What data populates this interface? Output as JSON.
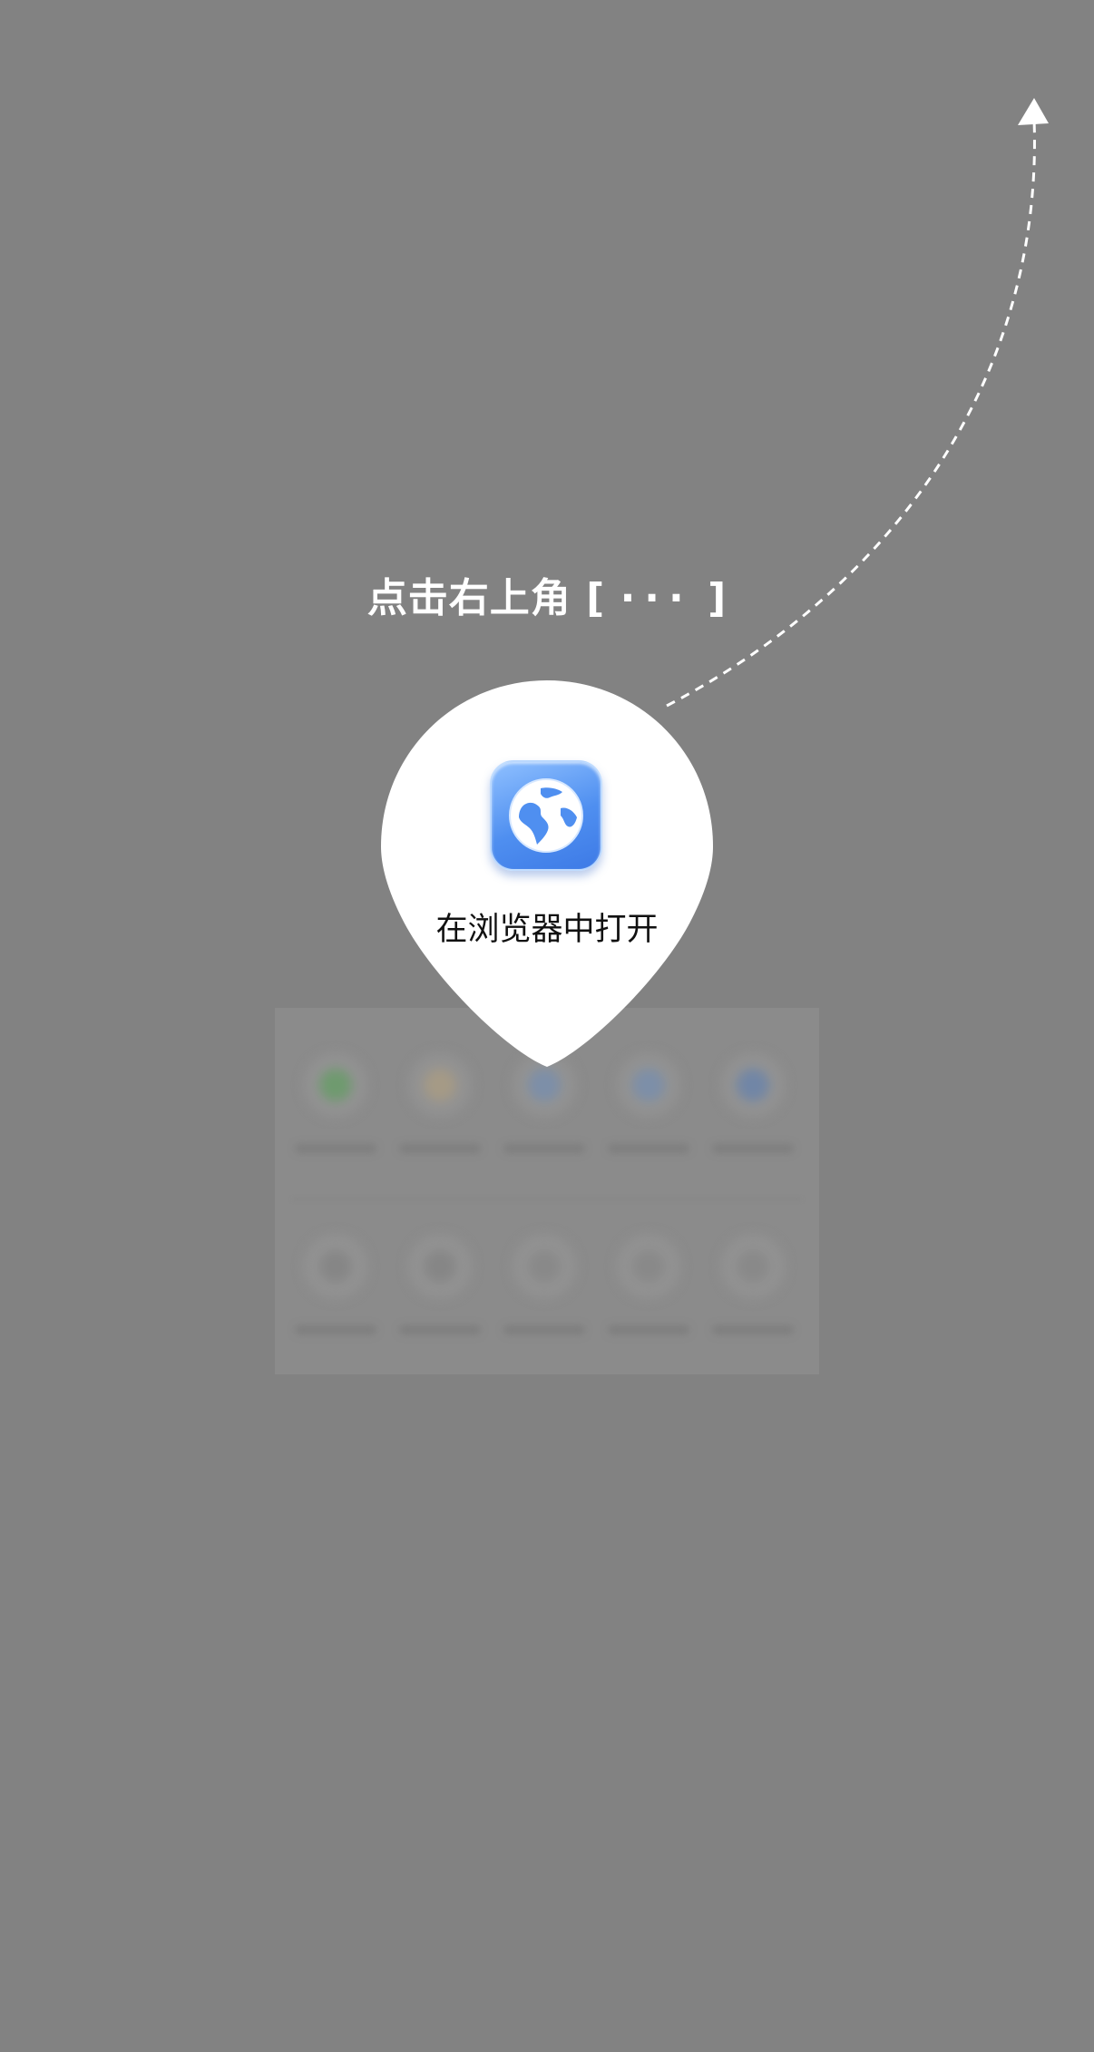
{
  "overlay": {
    "hint": {
      "prefix": "点击右上角 [",
      "dots": "···",
      "suffix": "]"
    },
    "open_in_browser": {
      "label": "在浏览器中打开",
      "icon": "globe-icon"
    },
    "arrow_icon": "dashed-arrow-up-right-icon"
  },
  "share_sheet": {
    "row1_icons": [
      "green-app-icon",
      "colorful-app-icon",
      "blue-app-icon",
      "blue-app-icon",
      "blue-app-icon"
    ],
    "row2_icons": [
      "action-icon",
      "action-icon",
      "action-icon",
      "action-icon",
      "action-icon"
    ]
  },
  "colors": {
    "backdrop": "#828282",
    "pin": "#ffffff",
    "icon_blue": "#4f8ff0",
    "hint_text": "#ffffff"
  }
}
